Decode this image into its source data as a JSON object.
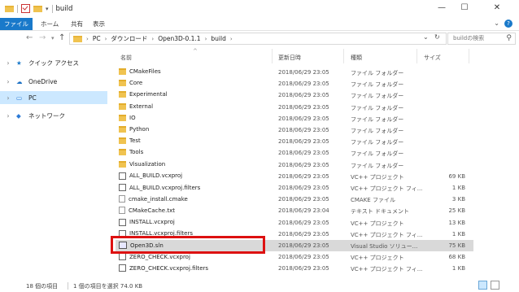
{
  "window": {
    "title": "build",
    "minimize": "—",
    "maximize": "☐",
    "close": "✕"
  },
  "ribbon": {
    "tabs": [
      "ファイル",
      "ホーム",
      "共有",
      "表示"
    ],
    "help": "?"
  },
  "address": {
    "crumbs": [
      "PC",
      "ダウンロード",
      "Open3D-0.1.1",
      "build"
    ],
    "search_placeholder": "buildの検索"
  },
  "nav": {
    "items": [
      {
        "label": "クイック アクセス",
        "icon": "star-icon"
      },
      {
        "label": "OneDrive",
        "icon": "cloud-icon"
      },
      {
        "label": "PC",
        "icon": "computer-icon"
      },
      {
        "label": "ネットワーク",
        "icon": "network-icon"
      }
    ],
    "selected": "PC"
  },
  "columns": {
    "name": "名前",
    "date": "更新日時",
    "type": "種類",
    "size": "サイズ"
  },
  "files": [
    {
      "name": "CMakeFiles",
      "date": "2018/06/29 23:05",
      "type": "ファイル フォルダー",
      "size": "",
      "icon": "folder"
    },
    {
      "name": "Core",
      "date": "2018/06/29 23:05",
      "type": "ファイル フォルダー",
      "size": "",
      "icon": "folder"
    },
    {
      "name": "Experimental",
      "date": "2018/06/29 23:05",
      "type": "ファイル フォルダー",
      "size": "",
      "icon": "folder"
    },
    {
      "name": "External",
      "date": "2018/06/29 23:05",
      "type": "ファイル フォルダー",
      "size": "",
      "icon": "folder"
    },
    {
      "name": "IO",
      "date": "2018/06/29 23:05",
      "type": "ファイル フォルダー",
      "size": "",
      "icon": "folder"
    },
    {
      "name": "Python",
      "date": "2018/06/29 23:05",
      "type": "ファイル フォルダー",
      "size": "",
      "icon": "folder"
    },
    {
      "name": "Test",
      "date": "2018/06/29 23:05",
      "type": "ファイル フォルダー",
      "size": "",
      "icon": "folder"
    },
    {
      "name": "Tools",
      "date": "2018/06/29 23:05",
      "type": "ファイル フォルダー",
      "size": "",
      "icon": "folder"
    },
    {
      "name": "Visualization",
      "date": "2018/06/29 23:05",
      "type": "ファイル フォルダー",
      "size": "",
      "icon": "folder"
    },
    {
      "name": "ALL_BUILD.vcxproj",
      "date": "2018/06/29 23:05",
      "type": "VC++ プロジェクト",
      "size": "69 KB",
      "icon": "proj"
    },
    {
      "name": "ALL_BUILD.vcxproj.filters",
      "date": "2018/06/29 23:05",
      "type": "VC++ プロジェクト フィ...",
      "size": "1 KB",
      "icon": "proj"
    },
    {
      "name": "cmake_install.cmake",
      "date": "2018/06/29 23:05",
      "type": "CMAKE ファイル",
      "size": "3 KB",
      "icon": "doc"
    },
    {
      "name": "CMakeCache.txt",
      "date": "2018/06/29 23:04",
      "type": "テキスト ドキュメント",
      "size": "25 KB",
      "icon": "doc"
    },
    {
      "name": "INSTALL.vcxproj",
      "date": "2018/06/29 23:05",
      "type": "VC++ プロジェクト",
      "size": "13 KB",
      "icon": "proj"
    },
    {
      "name": "INSTALL.vcxproj.filters",
      "date": "2018/06/29 23:05",
      "type": "VC++ プロジェクト フィ...",
      "size": "1 KB",
      "icon": "proj"
    },
    {
      "name": "Open3D.sln",
      "date": "2018/06/29 23:05",
      "type": "Visual Studio ソリュー...",
      "size": "75 KB",
      "icon": "sln",
      "selected": true
    },
    {
      "name": "ZERO_CHECK.vcxproj",
      "date": "2018/06/29 23:05",
      "type": "VC++ プロジェクト",
      "size": "68 KB",
      "icon": "proj"
    },
    {
      "name": "ZERO_CHECK.vcxproj.filters",
      "date": "2018/06/29 23:05",
      "type": "VC++ プロジェクト フィ...",
      "size": "1 KB",
      "icon": "proj"
    }
  ],
  "status": {
    "count": "18 個の項目",
    "selection": "1 個の項目を選択  74.0 KB"
  }
}
